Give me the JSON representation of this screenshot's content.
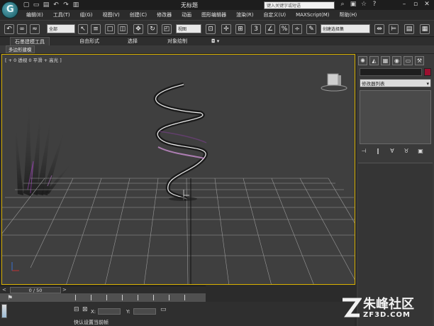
{
  "window": {
    "title": "无标题",
    "search_placeholder": "键入关键字或短语"
  },
  "menu": [
    "编辑(E)",
    "工具(T)",
    "组(G)",
    "视图(V)",
    "创建(C)",
    "修改器",
    "动画",
    "图形编辑器",
    "渲染(R)",
    "自定义(U)",
    "MAXScript(M)",
    "帮助(H)"
  ],
  "toolbar": {
    "selection_filter": "全部",
    "view_dropdown": "视图",
    "named_selection": "创建选择集"
  },
  "ribbon": {
    "tabs": [
      "石墨建模工具",
      "自由形式",
      "选择",
      "对象绘制"
    ],
    "active_subtab": "多边形建模"
  },
  "viewport": {
    "label": "[ + 0 透视 0 平滑 + 高光 ]"
  },
  "command_panel": {
    "modifier_list": "修改器列表"
  },
  "timeline": {
    "frame_display": "0 / 50",
    "tick_labels": [
      "10",
      "15",
      "20"
    ]
  },
  "status": {
    "x_label": "X:",
    "y_label": "Y:",
    "prompt": "单击或单击并拖动以选择对象",
    "hint": "快认设置当前帧"
  },
  "watermark": {
    "name": "朱峰社区",
    "url": "ZF3D.COM"
  },
  "colors": {
    "viewport_border": "#d8b000",
    "object_color": "#9c1030",
    "accent": "#5aa9b7"
  }
}
